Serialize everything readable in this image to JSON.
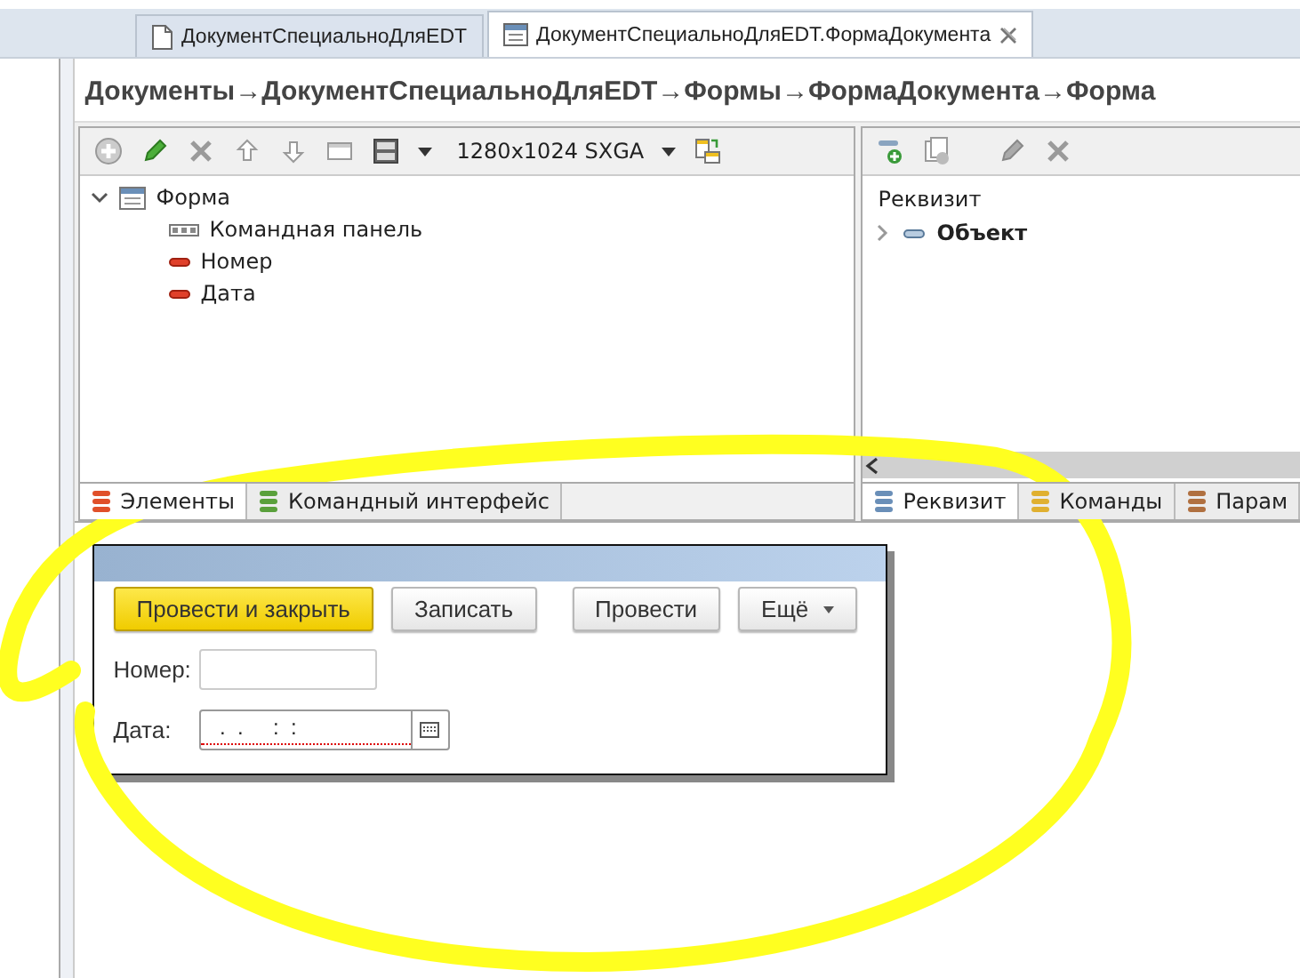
{
  "editor_tabs": [
    {
      "label": "ДокументСпециальноДляEDT",
      "selected": false,
      "closable": false
    },
    {
      "label": "ДокументСпециальноДляEDT.ФормаДокумента",
      "selected": true,
      "closable": true
    }
  ],
  "breadcrumb": "Документы→ДокументСпециальноДляEDT→Формы→ФормаДокумента→Форма",
  "elements_toolbar": {
    "resolution": "1280x1024 SXGA"
  },
  "elements_tree": [
    {
      "label": "Форма",
      "kind": "form",
      "expanded": true,
      "children": [
        {
          "label": "Командная панель",
          "kind": "command_bar"
        },
        {
          "label": "Номер",
          "kind": "field"
        },
        {
          "label": "Дата",
          "kind": "field"
        }
      ]
    }
  ],
  "left_tabs": [
    {
      "label": "Элементы",
      "selected": true,
      "color": "#e0502a"
    },
    {
      "label": "Командный интерфейс",
      "selected": false,
      "color": "#5aa03c"
    }
  ],
  "attributes_header": "Реквизит",
  "attributes_tree": [
    {
      "label": "Объект",
      "expanded": false
    }
  ],
  "right_tabs": [
    {
      "label": "Реквизит",
      "selected": true,
      "color": "#6a8fb8"
    },
    {
      "label": "Команды",
      "selected": false,
      "color": "#e0b030"
    },
    {
      "label": "Парам",
      "selected": false,
      "color": "#b07040"
    }
  ],
  "form_preview": {
    "buttons": [
      {
        "label": "Провести и закрыть",
        "default": true,
        "dropdown": false
      },
      {
        "label": "Записать",
        "default": false,
        "dropdown": false
      },
      {
        "label": "Провести",
        "default": false,
        "dropdown": false
      },
      {
        "label": "Ещё",
        "default": false,
        "dropdown": true
      }
    ],
    "fields": [
      {
        "label": "Номер:",
        "kind": "text"
      },
      {
        "label": "Дата:",
        "kind": "date",
        "value": "  .  .     :  :",
        "required": true
      }
    ]
  }
}
